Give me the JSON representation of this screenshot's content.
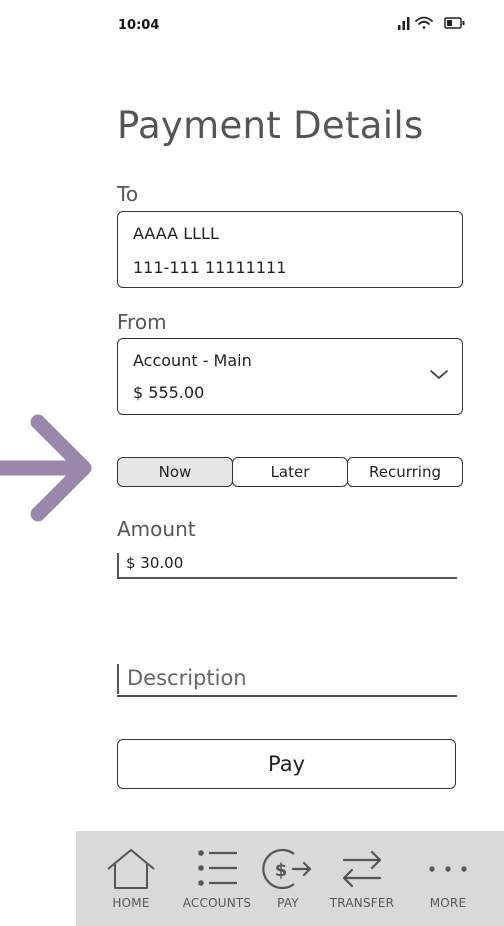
{
  "status_bar": {
    "time": "10:04"
  },
  "page": {
    "title": "Payment Details"
  },
  "to": {
    "label": "To",
    "name": "AAAA LLLL",
    "account_number": "111-111 11111111"
  },
  "from": {
    "label": "From",
    "account": "Account - Main",
    "balance": "$ 555.00"
  },
  "timing": {
    "options": [
      "Now",
      "Later",
      "Recurring"
    ],
    "selected": "Now"
  },
  "amount": {
    "label": "Amount",
    "value": "$ 30.00"
  },
  "description": {
    "placeholder": "Description"
  },
  "pay_button": {
    "label": "Pay"
  },
  "tabbar": {
    "items": [
      {
        "label": "HOME",
        "icon": "home-icon"
      },
      {
        "label": "ACCOUNTS",
        "icon": "list-icon"
      },
      {
        "label": "PAY",
        "icon": "pay-dollar-icon"
      },
      {
        "label": "TRANSFER",
        "icon": "transfer-arrows-icon"
      },
      {
        "label": "MORE",
        "icon": "more-dots-icon"
      }
    ]
  },
  "colors": {
    "annotation_arrow": "#9b87ac",
    "tabbar_bg": "#d9d9d9",
    "selected_segment": "#e6e6e6"
  }
}
